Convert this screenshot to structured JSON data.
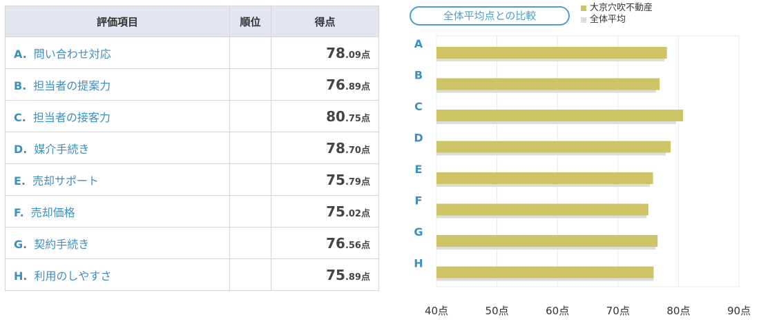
{
  "table": {
    "headers": {
      "item": "評価項目",
      "rank": "順位",
      "score": "得点"
    },
    "rows": [
      {
        "letter": "A.",
        "label": "問い合わせ対応",
        "rank": "",
        "score_int": "78",
        "score_dec": ".09",
        "unit": "点"
      },
      {
        "letter": "B.",
        "label": "担当者の提案力",
        "rank": "",
        "score_int": "76",
        "score_dec": ".89",
        "unit": "点"
      },
      {
        "letter": "C.",
        "label": "担当者の接客力",
        "rank": "",
        "score_int": "80",
        "score_dec": ".75",
        "unit": "点"
      },
      {
        "letter": "D.",
        "label": "媒介手続き",
        "rank": "",
        "score_int": "78",
        "score_dec": ".70",
        "unit": "点"
      },
      {
        "letter": "E.",
        "label": "売却サポート",
        "rank": "",
        "score_int": "75",
        "score_dec": ".79",
        "unit": "点"
      },
      {
        "letter": "F.",
        "label": "売却価格",
        "rank": "",
        "score_int": "75",
        "score_dec": ".02",
        "unit": "点"
      },
      {
        "letter": "G.",
        "label": "契約手続き",
        "rank": "",
        "score_int": "76",
        "score_dec": ".56",
        "unit": "点"
      },
      {
        "letter": "H.",
        "label": "利用のしやすさ",
        "rank": "",
        "score_int": "75",
        "score_dec": ".89",
        "unit": "点"
      }
    ]
  },
  "chart_data": {
    "type": "bar",
    "orientation": "horizontal",
    "title": "全体平均点との比較",
    "categories": [
      "A",
      "B",
      "C",
      "D",
      "E",
      "F",
      "G",
      "H"
    ],
    "series": [
      {
        "name": "大京穴吹不動産",
        "color": "#cdc565",
        "values": [
          78.09,
          76.89,
          80.75,
          78.7,
          75.79,
          75.02,
          76.56,
          75.89
        ]
      },
      {
        "name": "全体平均",
        "color": "#dcdcdc",
        "values": [
          77.7,
          76.3,
          79.6,
          77.9,
          75.3,
          74.7,
          76.2,
          75.9
        ]
      }
    ],
    "xlim": [
      40,
      90
    ],
    "xticks": [
      40,
      50,
      60,
      70,
      80,
      90
    ],
    "tick_labels": [
      "40点",
      "50点",
      "60点",
      "70点",
      "80点",
      "90点"
    ],
    "grid": true,
    "legend": "top-right"
  }
}
